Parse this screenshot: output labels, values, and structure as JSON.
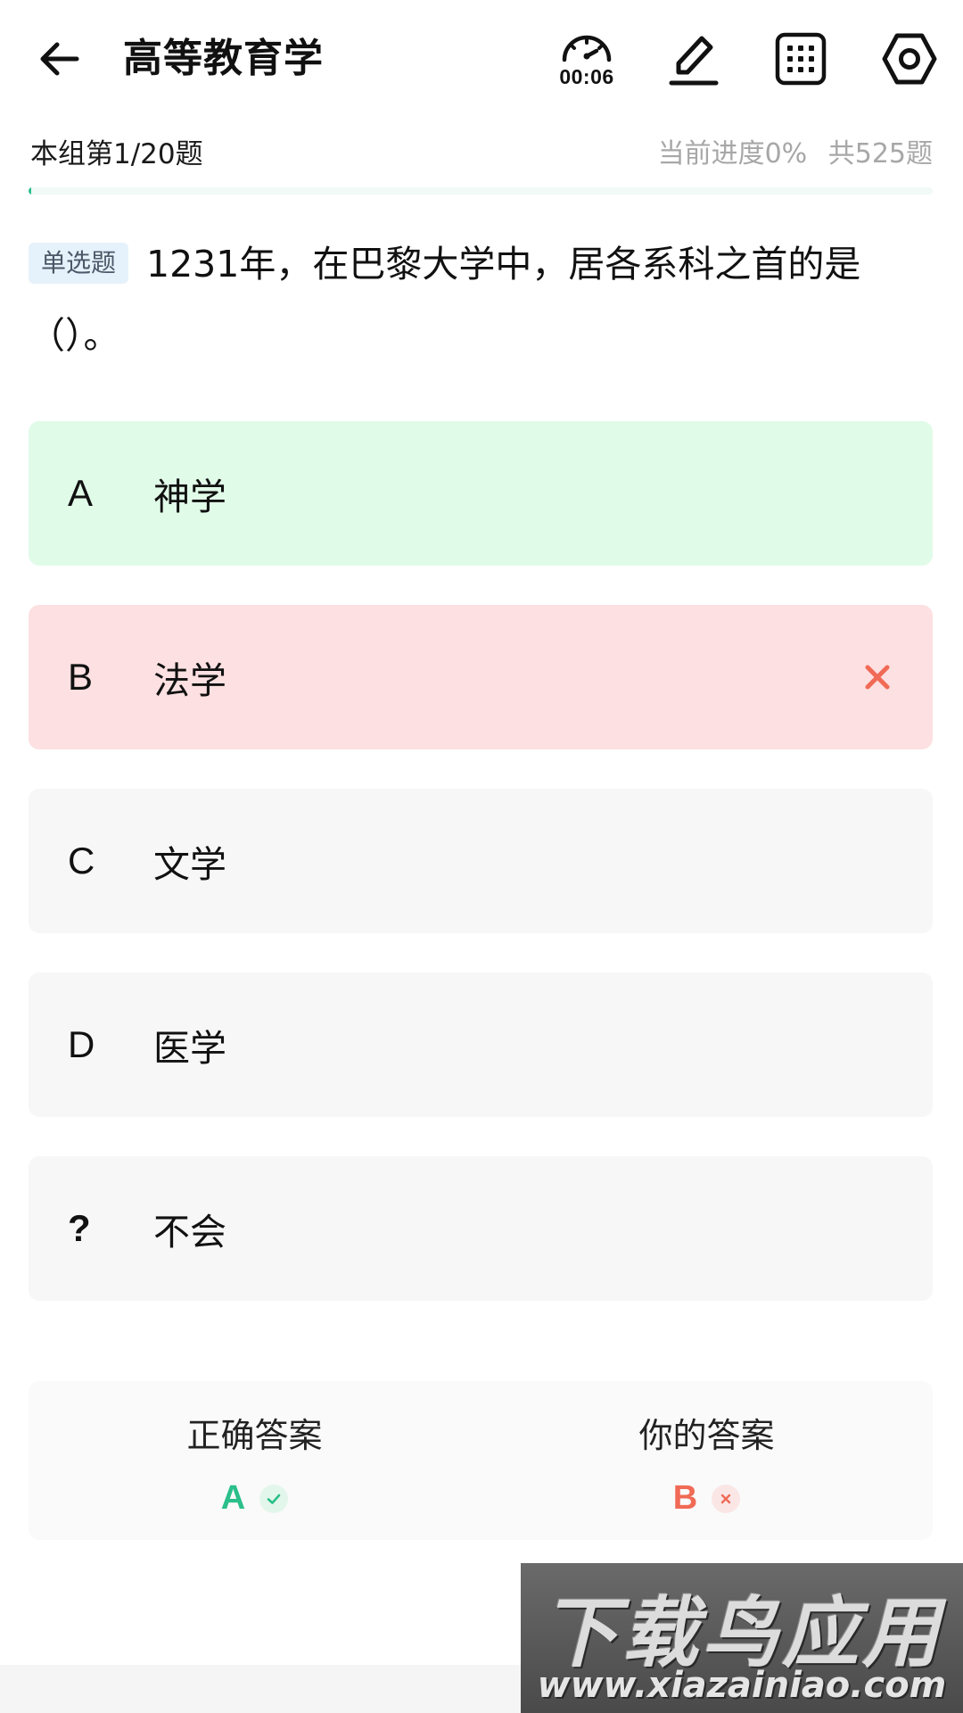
{
  "header": {
    "title": "高等教育学",
    "timer": "00:06",
    "icons": [
      "back-arrow-icon",
      "stopwatch-icon",
      "pencil-icon",
      "grid-icon",
      "settings-icon"
    ]
  },
  "subheader": {
    "group": "本组第1/20题",
    "progress": "当前进度0%",
    "total": "共525题",
    "progress_percent": 0
  },
  "question": {
    "type": "单选题",
    "text": "1231年，在巴黎大学中，居各系科之首的是（）。"
  },
  "options": [
    {
      "letter": "A",
      "text": "神学",
      "state": "correct"
    },
    {
      "letter": "B",
      "text": "法学",
      "state": "wrong"
    },
    {
      "letter": "C",
      "text": "文学",
      "state": "normal"
    },
    {
      "letter": "D",
      "text": "医学",
      "state": "normal"
    },
    {
      "letter": "?",
      "text": "不会",
      "state": "normal"
    }
  ],
  "answer": {
    "correct_label": "正确答案",
    "correct_value": "A",
    "yours_label": "你的答案",
    "yours_value": "B"
  },
  "colors": {
    "accent_green": "#2bbf8a",
    "error_red": "#f06a55",
    "correct_bg": "#e1fbe9",
    "wrong_bg": "#fde0e1",
    "option_bg": "#f7f7f7"
  },
  "watermark": {
    "logo": "下载鸟应用",
    "url": "www.xiazainiao.com"
  }
}
